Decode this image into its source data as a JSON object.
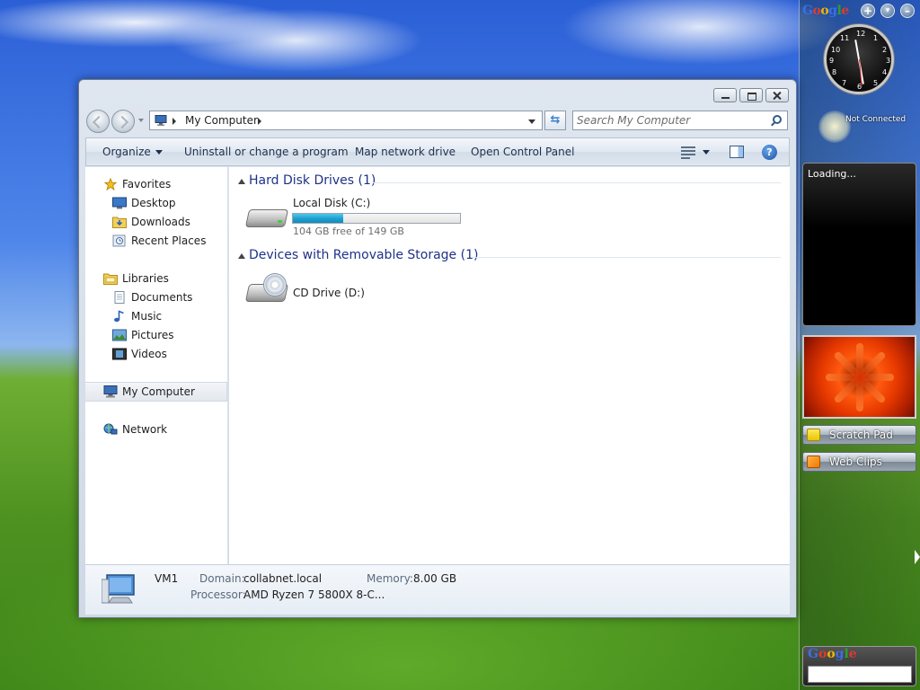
{
  "sidebar": {
    "google_logo": "Google",
    "controls": [
      "+",
      "▾",
      "–"
    ],
    "clock": {
      "numbers": [
        "12",
        "1",
        "2",
        "3",
        "4",
        "5",
        "6",
        "7",
        "8",
        "9",
        "10",
        "11"
      ]
    },
    "weather": {
      "status": "Not Connected"
    },
    "feed": {
      "status": "Loading..."
    },
    "buttons": [
      {
        "label": "Scratch Pad",
        "icon": "note-icon"
      },
      {
        "label": "Web Clips",
        "icon": "rss-icon"
      }
    ],
    "search": {
      "logo": "Google"
    }
  },
  "window": {
    "address": {
      "crumb": "My Computer"
    },
    "search": {
      "placeholder": "Search My Computer"
    },
    "toolbar": {
      "organize": "Organize",
      "uninstall": "Uninstall or change a program",
      "map_drive": "Map network drive",
      "control_panel": "Open Control Panel",
      "help": "?"
    },
    "nav": {
      "favorites": "Favorites",
      "desktop": "Desktop",
      "downloads": "Downloads",
      "recent": "Recent Places",
      "libraries": "Libraries",
      "documents": "Documents",
      "music": "Music",
      "pictures": "Pictures",
      "videos": "Videos",
      "computer": "My Computer",
      "network": "Network"
    },
    "groups": {
      "hdd": {
        "title": "Hard Disk Drives (1)",
        "drive": {
          "name": "Local Disk (C:)",
          "free_text": "104 GB free of 149 GB",
          "used_fraction": 0.3
        }
      },
      "removable": {
        "title": "Devices with Removable Storage (1)",
        "drive": {
          "name": "CD Drive (D:)"
        }
      }
    },
    "details": {
      "computer_name": "VM1",
      "domain_label": "Domain:",
      "domain_value": "collabnet.local",
      "memory_label": "Memory:",
      "memory_value": "8.00 GB",
      "processor_label": "Processor:",
      "processor_value": "AMD Ryzen 7 5800X 8-C..."
    }
  },
  "colors": {
    "accent": "#1e3287",
    "usage_fill": "#1d9fcf"
  }
}
